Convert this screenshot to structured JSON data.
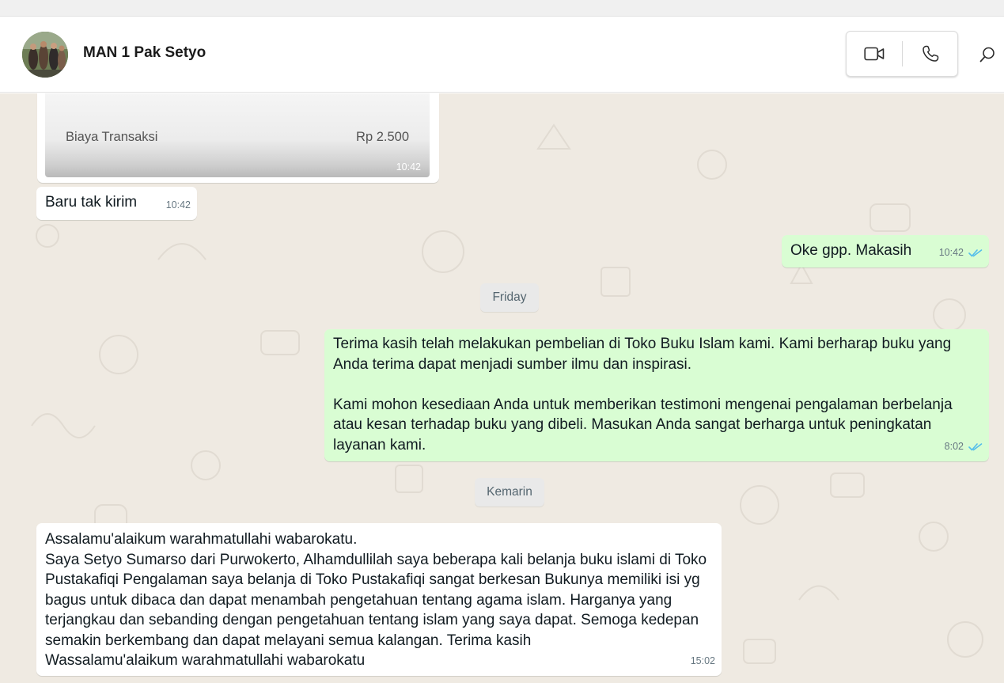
{
  "header": {
    "contact_name": "MAN 1 Pak Setyo"
  },
  "toolbar": {
    "icons": [
      "video-call-icon",
      "voice-call-icon",
      "search-icon"
    ]
  },
  "colors": {
    "incoming_bubble": "#ffffff",
    "outgoing_bubble": "#d9fdd3",
    "read_ticks": "#53bdeb",
    "chat_background": "#efeae2"
  },
  "messages": {
    "receipt": {
      "label": "Biaya Transaksi",
      "amount": "Rp 2.500",
      "time": "10:42"
    },
    "m1": {
      "text": "Baru tak kirim",
      "time": "10:42"
    },
    "m2": {
      "text": "Oke gpp. Makasih",
      "time": "10:42",
      "status": "read"
    },
    "date_friday": "Friday",
    "m3": {
      "text": "Terima kasih telah melakukan pembelian di Toko Buku Islam kami. Kami berharap buku yang Anda terima dapat menjadi sumber ilmu dan inspirasi.\n\nKami mohon kesediaan Anda untuk memberikan testimoni mengenai pengalaman berbelanja atau kesan terhadap buku yang dibeli. Masukan Anda sangat berharga untuk peningkatan layanan kami.",
      "time": "8:02",
      "status": "read"
    },
    "date_yesterday": "Kemarin",
    "m4": {
      "text": "Assalamu'alaikum warahmatullahi wabarokatu.\nSaya Setyo Sumarso dari Purwokerto, Alhamdullilah saya beberapa kali belanja buku islami di Toko Pustakafiqi Pengalaman saya belanja di Toko Pustakafiqi sangat berkesan Bukunya memiliki isi yg bagus untuk dibaca dan dapat menambah pengetahuan tentang agama islam. Harganya yang terjangkau dan sebanding dengan pengetahuan tentang islam yang saya dapat. Semoga kedepan semakin berkembang dan dapat melayani semua kalangan. Terima kasih\nWassalamu'alaikum warahmatullahi wabarokatu",
      "time": "15:02"
    }
  }
}
